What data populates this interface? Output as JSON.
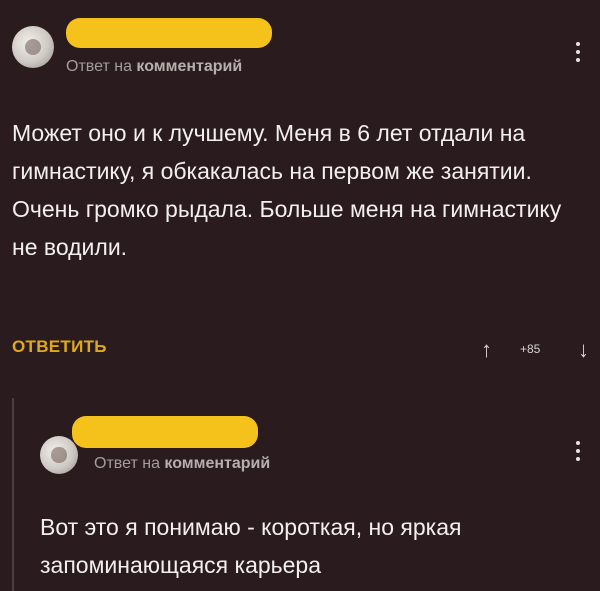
{
  "comments": [
    {
      "reply_prefix": "Ответ на",
      "reply_target": "комментарий",
      "text": "Может оно и к лучшему. Меня в 6 лет отдали на гимнастику, я обкакалась на первом же занятии. Очень громко рыдала. Больше меня на гимнастику не водили.",
      "reply_label": "ОТВЕТИТЬ",
      "vote_up": "↑",
      "score": "+85",
      "vote_down": "↓"
    },
    {
      "reply_prefix": "Ответ на",
      "reply_target": "комментарий",
      "text": "Вот это я понимаю - короткая, но яркая запоминающаяся карьера"
    }
  ],
  "colors": {
    "background": "#2a1c1e",
    "username_redaction": "#f5c21b",
    "reply_button": "#e0a91a",
    "body_text": "#f3efed",
    "meta_text": "#a39d9b"
  },
  "icons": {
    "more": "more-vertical-icon",
    "upvote": "arrow-up-icon",
    "downvote": "arrow-down-icon"
  }
}
